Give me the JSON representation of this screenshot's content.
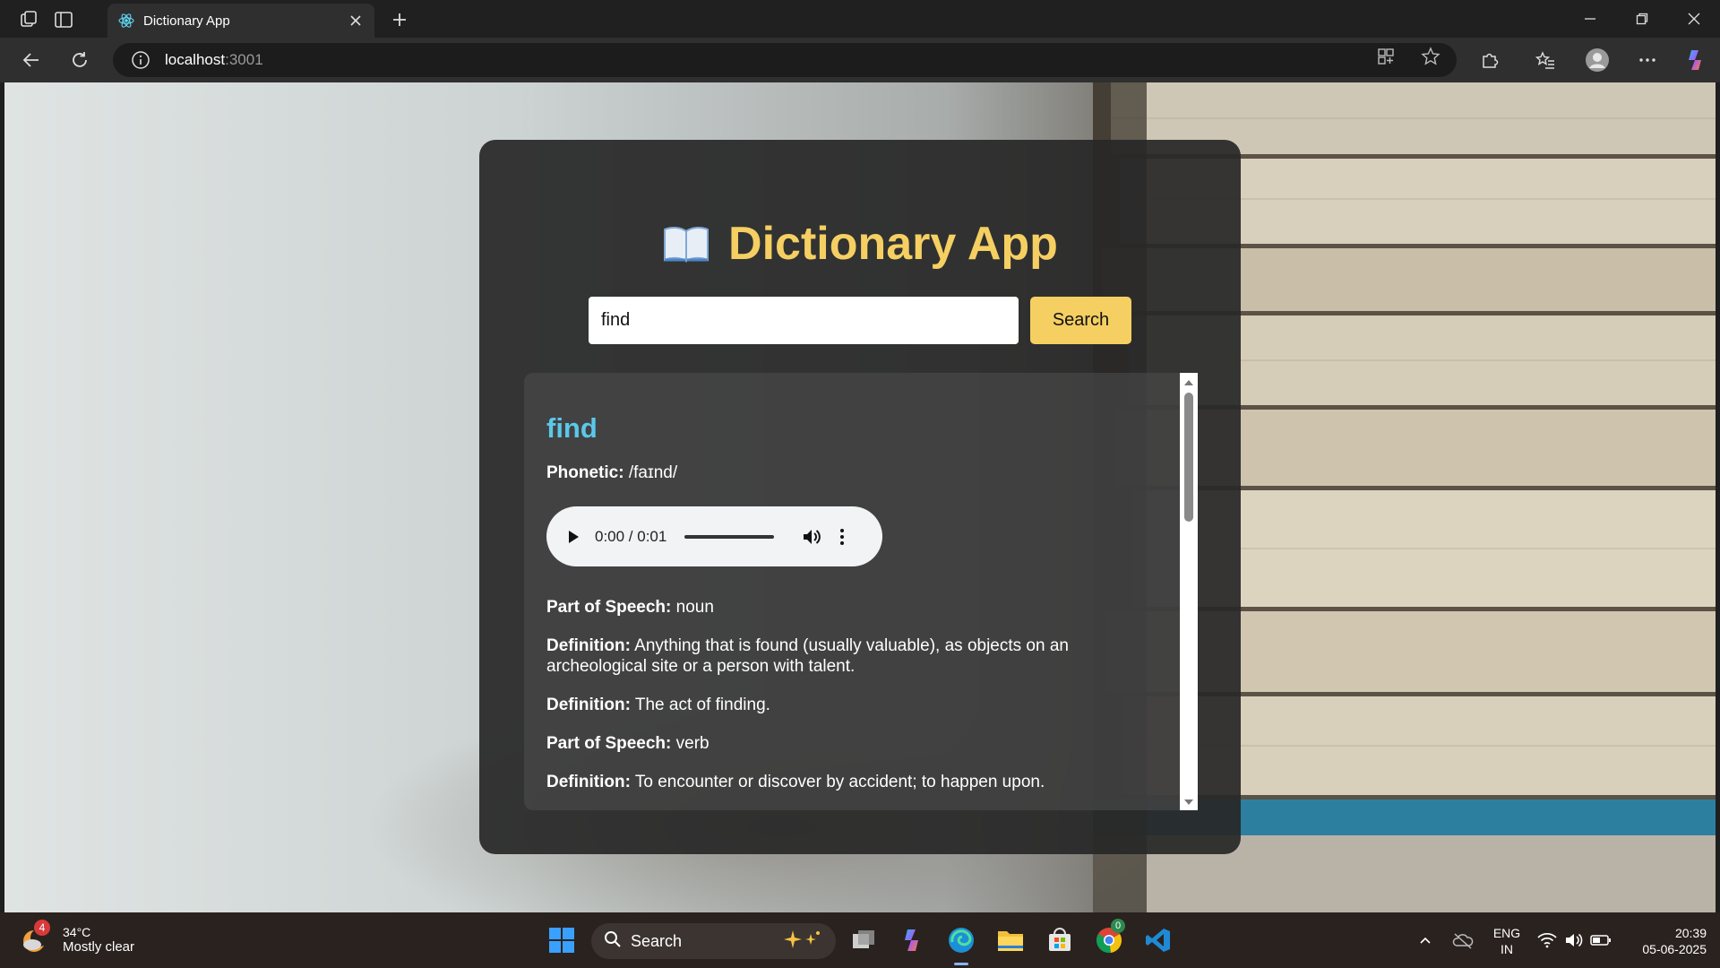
{
  "browser": {
    "tab_title": "Dictionary App",
    "url_host": "localhost",
    "url_port": ":3001"
  },
  "app": {
    "title": "Dictionary App",
    "search_value": "find",
    "search_button": "Search"
  },
  "result": {
    "word": "find",
    "phonetic_label": "Phonetic:",
    "phonetic": "/faɪnd/",
    "audio_time": "0:00 / 0:01",
    "entries": [
      {
        "label": "Part of Speech:",
        "text": "noun"
      },
      {
        "label": "Definition:",
        "text": "Anything that is found (usually valuable), as objects on an archeological site or a person with talent."
      },
      {
        "label": "Definition:",
        "text": "The act of finding."
      },
      {
        "label": "Part of Speech:",
        "text": "verb"
      },
      {
        "label": "Definition:",
        "text": "To encounter or discover by accident; to happen upon."
      }
    ]
  },
  "taskbar": {
    "weather_badge": "4",
    "temperature": "34°C",
    "condition": "Mostly clear",
    "search_label": "Search",
    "lang_line1": "ENG",
    "lang_line2": "IN",
    "time": "20:39",
    "date": "05-06-2025",
    "chrome_badge": "0"
  },
  "colors": {
    "accent_yellow": "#f5cf62",
    "word_blue": "#5ac8ea",
    "card_bg": "#282828"
  }
}
